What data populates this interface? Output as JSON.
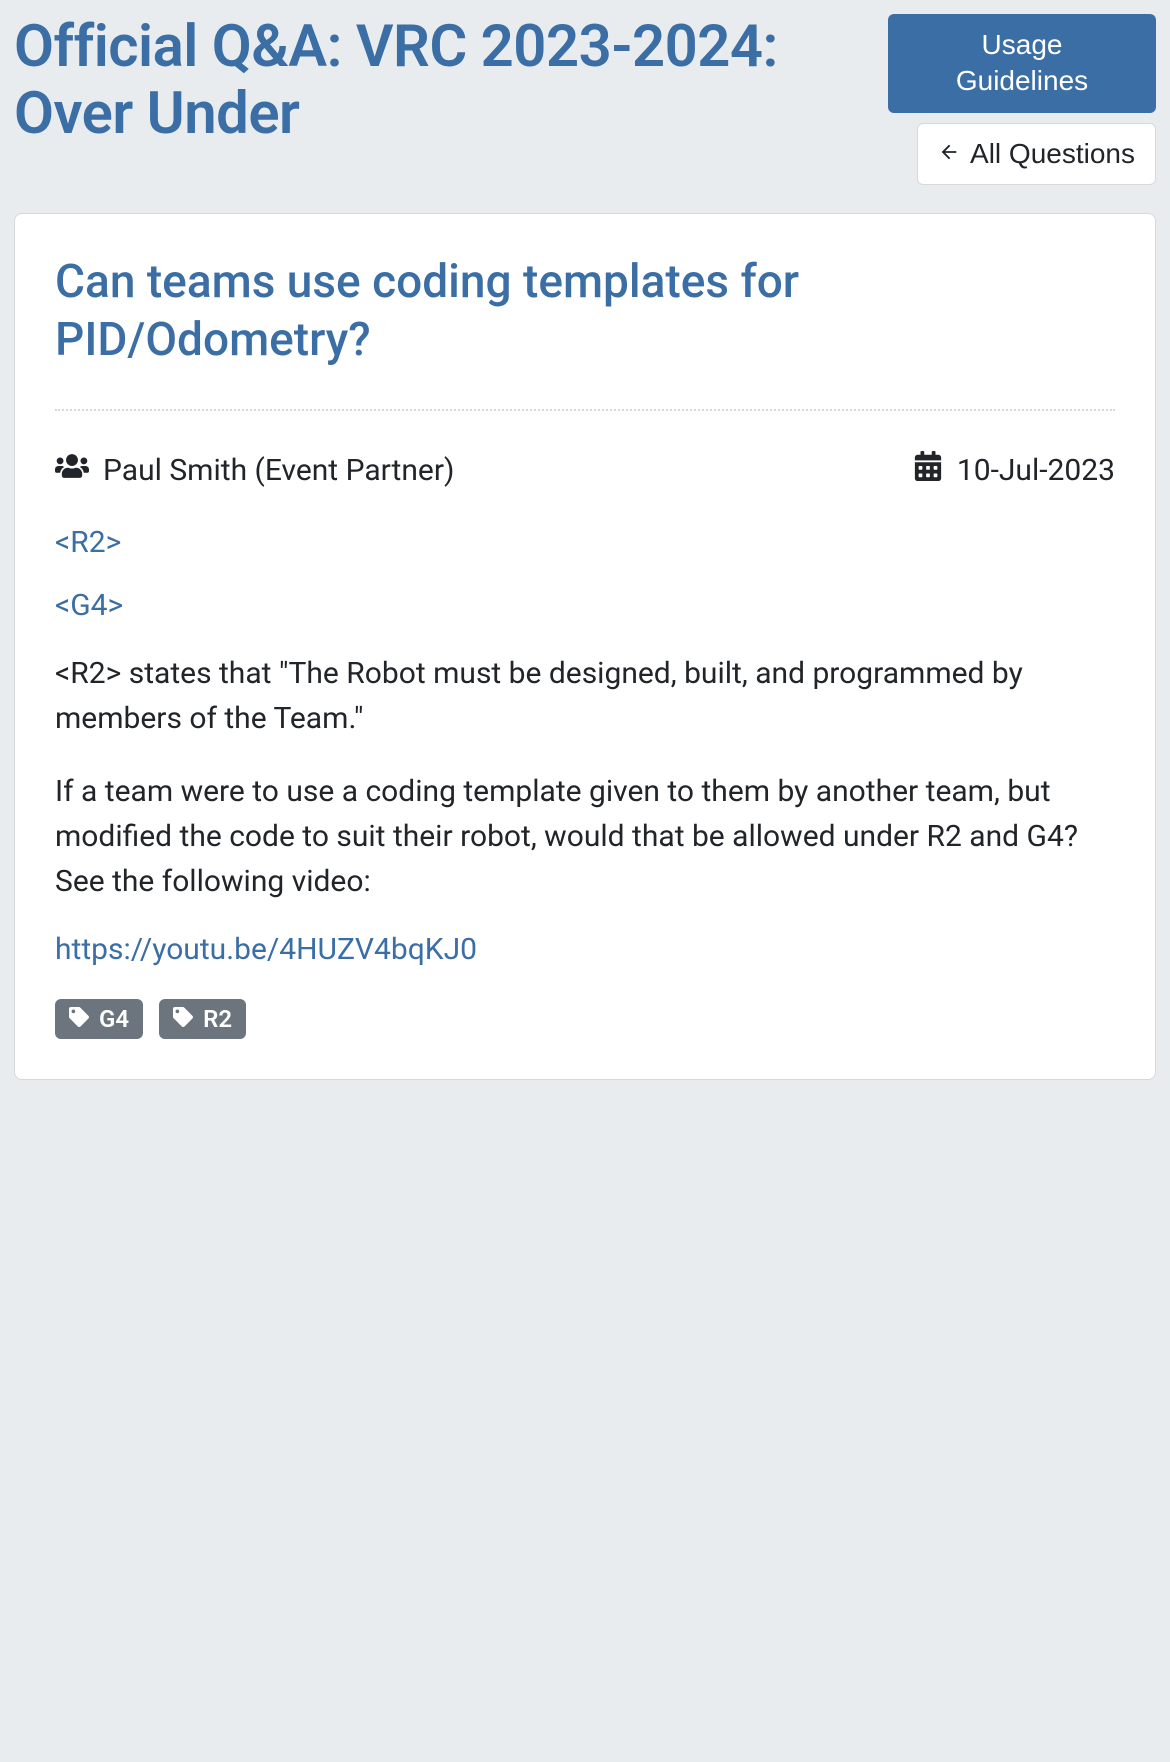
{
  "header": {
    "title": "Official Q&A: VRC 2023-2024: Over Under",
    "usage_btn": "Usage Guidelines",
    "all_questions_btn": "All Questions"
  },
  "question": {
    "title": "Can teams use coding templates for PID/Odometry?",
    "author": "Paul Smith (Event Partner)",
    "date": "10-Jul-2023",
    "rule_links": [
      "<R2>",
      "<G4>"
    ],
    "paragraphs": [
      "<R2> states that \"The Robot must be designed, built, and programmed by members of the Team.\"",
      "If a team were to use a coding template given to them by another team, but modified the code to suit their robot, would that be allowed under R2 and G4? See the following video:"
    ],
    "video_url": "https://youtu.be/4HUZV4bqKJ0",
    "tags": [
      "G4",
      "R2"
    ]
  }
}
